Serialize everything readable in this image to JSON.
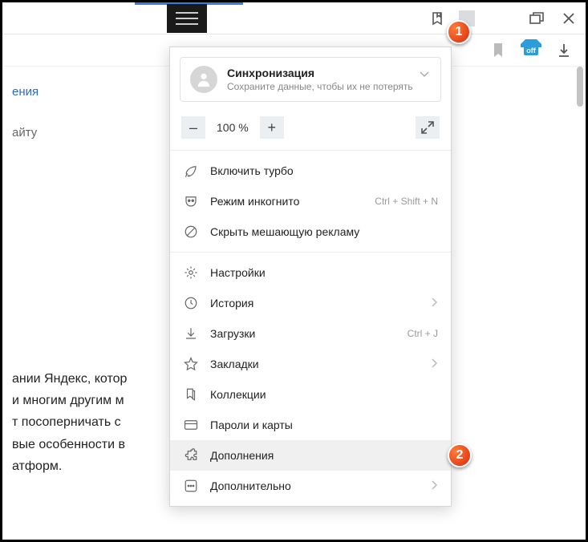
{
  "topbar": {
    "callout1": "1"
  },
  "sync": {
    "title": "Синхронизация",
    "subtitle": "Сохраните данные, чтобы их не потерять"
  },
  "zoom": {
    "minus": "–",
    "value": "100 %",
    "plus": "+"
  },
  "menu": {
    "turbo": "Включить турбо",
    "incognito": "Режим инкогнито",
    "incognito_shortcut": "Ctrl + Shift + N",
    "hide_ads": "Скрыть мешающую рекламу",
    "settings": "Настройки",
    "history": "История",
    "downloads": "Загрузки",
    "downloads_shortcut": "Ctrl + J",
    "bookmarks": "Закладки",
    "collections": "Коллекции",
    "passwords": "Пароли и карты",
    "addons": "Дополнения",
    "more": "Дополнительно",
    "callout2": "2"
  },
  "background": {
    "link_fragment": "ения",
    "plain_fragment": "айту",
    "para_l1": "ании Яндекс, котор",
    "para_l2": "и многим другим м",
    "para_l3": "т посоперничать с",
    "para_l4": "вые особенности в",
    "para_l5": "атформ."
  },
  "off_badge": "off"
}
